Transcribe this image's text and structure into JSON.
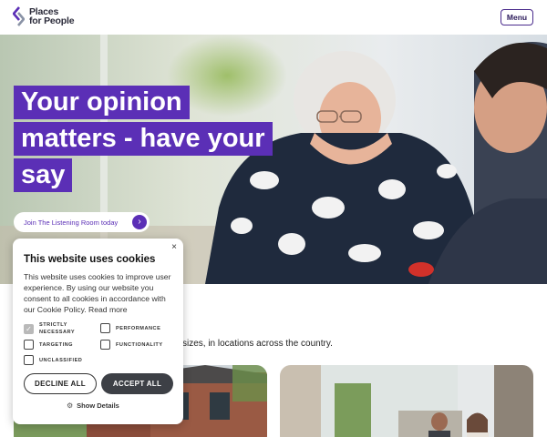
{
  "header": {
    "logo_line1": "Places",
    "logo_line2": "for People",
    "menu_label": "Menu"
  },
  "hero": {
    "headline_lines": [
      "Your opinion",
      "matters - have your",
      "say"
    ],
    "cta_label": "Join The Listening Room today",
    "cta_arrow": "›"
  },
  "main": {
    "body_text_visible": "sizes, in locations across the country."
  },
  "cookie_banner": {
    "close_glyph": "×",
    "title": "This website uses cookies",
    "description": "This website uses cookies to improve user experience. By using our website you consent to all cookies in accordance with our Cookie Policy. Read more",
    "options": [
      {
        "label": "STRICTLY NECESSARY",
        "checked": true
      },
      {
        "label": "PERFORMANCE",
        "checked": false
      },
      {
        "label": "TARGETING",
        "checked": false
      },
      {
        "label": "FUNCTIONALITY",
        "checked": false
      },
      {
        "label": "UNCLASSIFIED",
        "checked": false
      }
    ],
    "decline_label": "DECLINE ALL",
    "accept_label": "ACCEPT ALL",
    "show_details_label": "Show Details",
    "gear_icon": "gear-icon"
  },
  "colors": {
    "brand_purple": "#5b2fb6",
    "accept_button": "#3d4046",
    "menu_border": "#4a2b8c"
  }
}
